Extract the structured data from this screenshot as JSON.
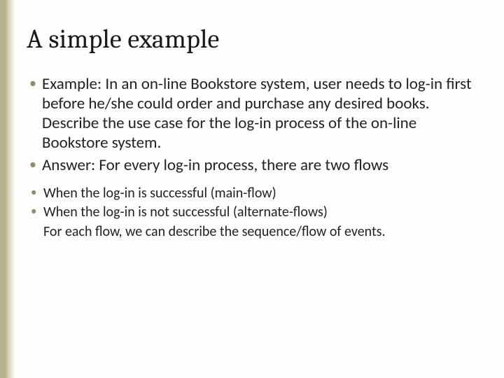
{
  "title": "A simple example",
  "bullets": [
    "Example: In an on-line Bookstore system,  user needs to log-in first before he/she could order and purchase any desired books. Describe the use case for the log-in process of the on-line Bookstore system.",
    "Answer: For every log-in process, there are two flows"
  ],
  "sub_bullets": [
    "When the log-in is successful (main-flow)",
    "When the log-in is not successful (alternate-flows)"
  ],
  "sub_plain": "For each flow, we can describe the sequence/flow of events."
}
